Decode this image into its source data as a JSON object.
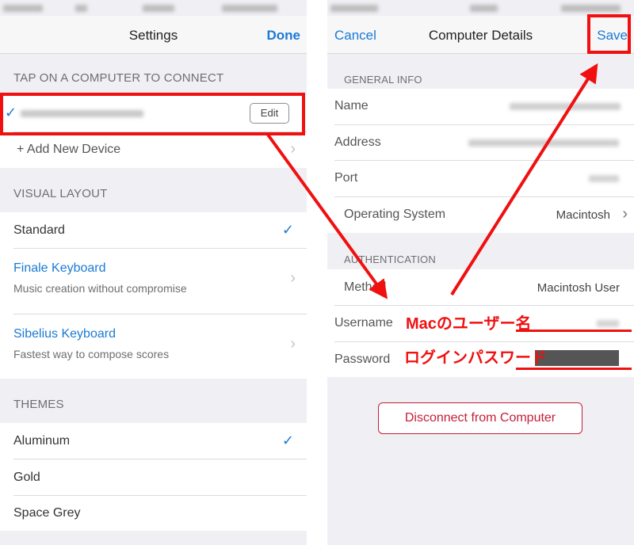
{
  "left": {
    "nav": {
      "title": "Settings",
      "done_label": "Done"
    },
    "connect_section": {
      "header": "TAP ON A COMPUTER TO CONNECT",
      "edit_label": "Edit",
      "add_device_label": "+ Add New Device"
    },
    "visual_layout": {
      "header": "VISUAL LAYOUT",
      "standard": "Standard",
      "finale": {
        "title": "Finale Keyboard",
        "subtitle": "Music creation without compromise"
      },
      "sibelius": {
        "title": "Sibelius Keyboard",
        "subtitle": "Fastest way to compose scores"
      }
    },
    "themes": {
      "header": "THEMES",
      "items": [
        "Aluminum",
        "Gold",
        "Space Grey"
      ]
    }
  },
  "right": {
    "nav": {
      "cancel_label": "Cancel",
      "title": "Computer Details",
      "save_label": "Save"
    },
    "general_info": {
      "header": "GENERAL INFO",
      "name_label": "Name",
      "address_label": "Address",
      "port_label": "Port",
      "os_label": "Operating System",
      "os_value": "Macintosh"
    },
    "authentication": {
      "header": "AUTHENTICATION",
      "method_label": "Method",
      "method_value": "Macintosh User",
      "username_label": "Username",
      "password_label": "Password"
    },
    "disconnect_label": "Disconnect from Computer"
  },
  "annotations": {
    "username_note": "Macのユーザー名",
    "password_note": "ログインパスワード"
  },
  "colors": {
    "accent": "#1a7ad4",
    "annotation_red": "#f01010",
    "destructive": "#c41e3a"
  }
}
